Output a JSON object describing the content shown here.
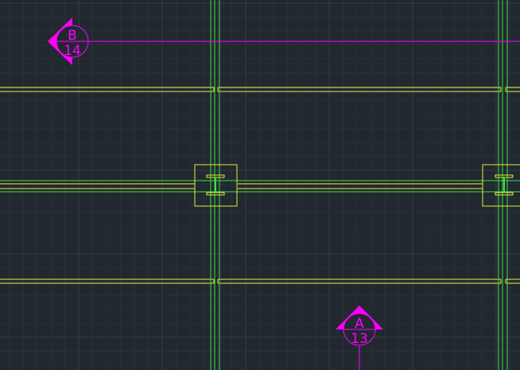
{
  "colors": {
    "background": "#212830",
    "grid_minor": "#283039",
    "grid_major": "#323b46",
    "beam": "#f0f04a",
    "column_line": "#3fe03f",
    "column_plate": "#e8e840",
    "section_marker": "#ff00ff"
  },
  "markers": [
    {
      "letter": "B",
      "number": "14",
      "direction": "left"
    },
    {
      "letter": "A",
      "number": "13",
      "direction": "up"
    }
  ]
}
